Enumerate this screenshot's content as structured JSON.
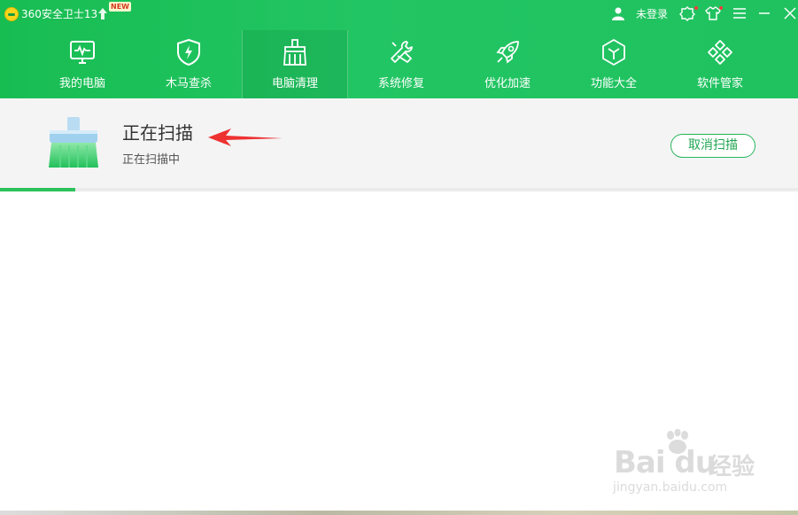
{
  "app": {
    "title": "360安全卫士13",
    "new_badge": "NEW",
    "login_label": "未登录",
    "brand_color": "#20c25f"
  },
  "titlebar_icons": [
    "user-icon",
    "skin-refresh-icon",
    "shirt-icon",
    "menu-icon",
    "minimize-icon",
    "close-icon"
  ],
  "nav": {
    "items": [
      {
        "label": "我的电脑",
        "icon": "monitor-icon"
      },
      {
        "label": "木马查杀",
        "icon": "shield-icon"
      },
      {
        "label": "电脑清理",
        "icon": "broom-icon",
        "active": true
      },
      {
        "label": "系统修复",
        "icon": "wrench-icon"
      },
      {
        "label": "优化加速",
        "icon": "rocket-icon"
      },
      {
        "label": "功能大全",
        "icon": "cube-icon"
      },
      {
        "label": "软件管家",
        "icon": "apps-icon"
      }
    ]
  },
  "scan": {
    "title": "正在扫描",
    "subtitle": "正在扫描中",
    "cancel_label": "取消扫描",
    "progress_fraction": 0.094
  },
  "watermark": {
    "brand": "Bai  du",
    "cn": "经验",
    "url": "jingyan.baidu.com"
  }
}
